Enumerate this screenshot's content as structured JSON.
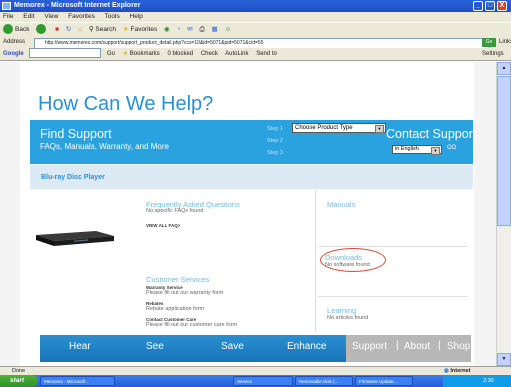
{
  "window": {
    "title": "Memorex - Microsoft Internet Explorer",
    "min": "_",
    "max": "□",
    "close": "X"
  },
  "menu": [
    "File",
    "Edit",
    "View",
    "Favorites",
    "Tools",
    "Help"
  ],
  "toolbar": {
    "back": "Back",
    "search": "Search",
    "favorites": "Favorites"
  },
  "address": {
    "label": "Address",
    "url": "http://www.memorex.com/support/support_product_detail.php?ccs=10&id=5071&pid=5071&cid=55",
    "go": "Go",
    "links": "Links"
  },
  "googlebar": {
    "logo": "Google",
    "go": "Go",
    "bookmarks": "Bookmarks",
    "blocked": "0 blocked",
    "check": "Check",
    "autolink": "AutoLink",
    "sendto": "Send to",
    "settings": "Settings"
  },
  "page": {
    "help_title": "How Can We Help?",
    "find_title": "Find Support",
    "find_sub": "FAQs, Manuals, Warranty, and More",
    "steps": [
      "Step 1",
      "Step 2",
      "Step 3"
    ],
    "product_select": "Choose Product Type",
    "contact_title": "Contact Support",
    "lang_select": "in English",
    "go": "GO",
    "crumb": "Blu-ray Disc Player",
    "faq": {
      "title": "Frequently Asked Questions",
      "note": "No specific FAQs found",
      "link": "VIEW ALL FAQ>"
    },
    "manuals": "Manuals",
    "downloads": {
      "title": "Downloads",
      "note": "No software found."
    },
    "cs": {
      "title": "Customer Services",
      "warranty": "Warranty Service",
      "warranty_note": "Please fill out our warranty form",
      "rebates": "Rebates",
      "rebates_note": "Rebate application form",
      "contact": "Contact Customer Care",
      "contact_note": "Please fill out our customer care form"
    },
    "learning": {
      "title": "Learning",
      "note": "No articles found"
    },
    "nav": [
      "Hear",
      "See",
      "Save",
      "Enhance",
      "Support",
      "About",
      "Shop"
    ]
  },
  "status": {
    "text": "Done",
    "zone": "Internet"
  },
  "taskbar": {
    "start": "start",
    "tasks": [
      "Memorex - Microsoft...",
      "Service",
      "Removable Disk (...",
      "Firmware Update..."
    ],
    "clock": "2:30"
  },
  "colors": {
    "accent": "#29a2df",
    "nav": "#1f86c8",
    "highlight": "#d64a3a"
  }
}
